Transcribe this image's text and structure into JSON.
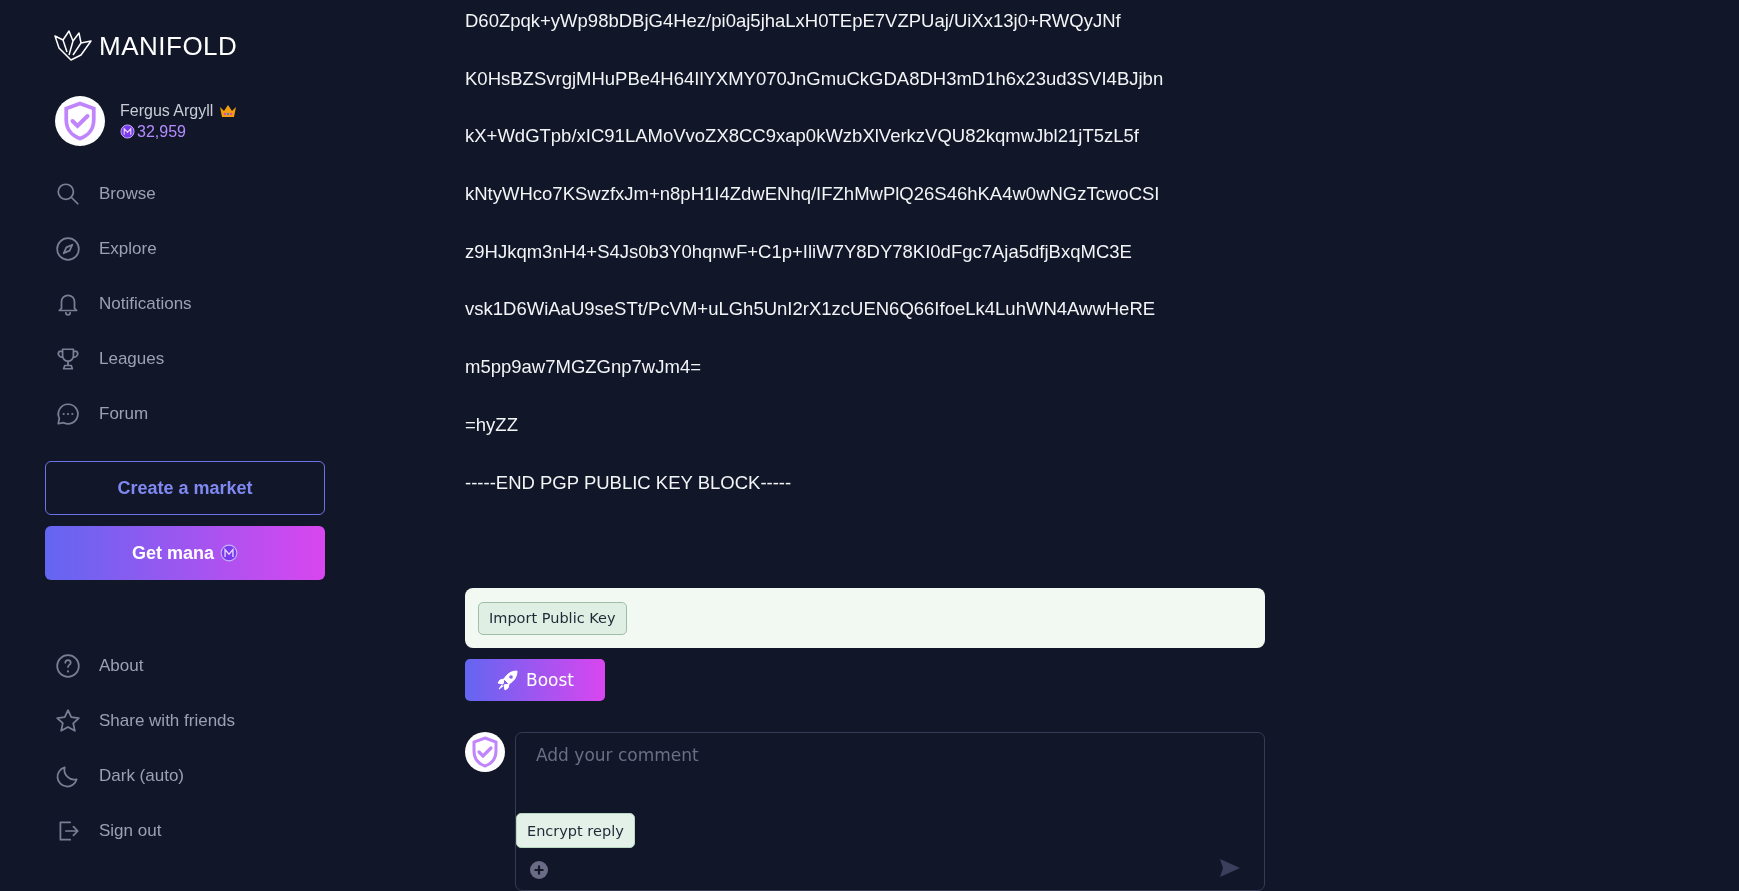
{
  "sidebar": {
    "logo": "MANIFOLD",
    "user": {
      "name": "Fergus Argyll",
      "balance": "32,959"
    },
    "nav": [
      {
        "kind": "search",
        "label": "Browse"
      },
      {
        "kind": "compass",
        "label": "Explore"
      },
      {
        "kind": "bell",
        "label": "Notifications"
      },
      {
        "kind": "trophy",
        "label": "Leagues"
      },
      {
        "kind": "chat",
        "label": "Forum"
      }
    ],
    "create_button": "Create a market",
    "mana_button": "Get mana",
    "footer_nav": [
      {
        "kind": "help",
        "label": "About"
      },
      {
        "kind": "star",
        "label": "Share with friends"
      },
      {
        "kind": "moon",
        "label": "Dark (auto)"
      },
      {
        "kind": "signout",
        "label": "Sign out"
      }
    ]
  },
  "post": {
    "lines": [
      "D60Zpqk+yWp98bDBjG4Hez/pi0aj5jhaLxH0TEpE7VZPUaj/UiXx13j0+RWQyJNf",
      "K0HsBZSvrgjMHuPBe4H64IlYXMY070JnGmuCkGDA8DH3mD1h6x23ud3SVI4BJjbn",
      "kX+WdGTpb/xIC91LAMoVvoZX8CC9xap0kWzbXlVerkzVQU82kqmwJbl21jT5zL5f",
      "kNtyWHco7KSwzfxJm+n8pH1I4ZdwENhq/IFZhMwPlQ26S46hKA4w0wNGzTcwoCSI",
      "z9HJkqm3nH4+S4Js0b3Y0hqnwF+C1p+IliW7Y8DY78KI0dFgc7Aja5dfjBxqMC3E",
      "vsk1D6WiAaU9seSTt/PcVM+uLGh5UnI2rX1zcUEN6Q66IfoeLk4LuhWN4AwwHeRE",
      "m5pp9aw7MGZGnp7wJm4=",
      "=hyZZ",
      "-----END PGP PUBLIC KEY BLOCK-----"
    ],
    "import_button": "Import Public Key",
    "boost_button": "Boost"
  },
  "comment": {
    "placeholder": "Add your comment",
    "encrypt_button": "Encrypt reply"
  }
}
